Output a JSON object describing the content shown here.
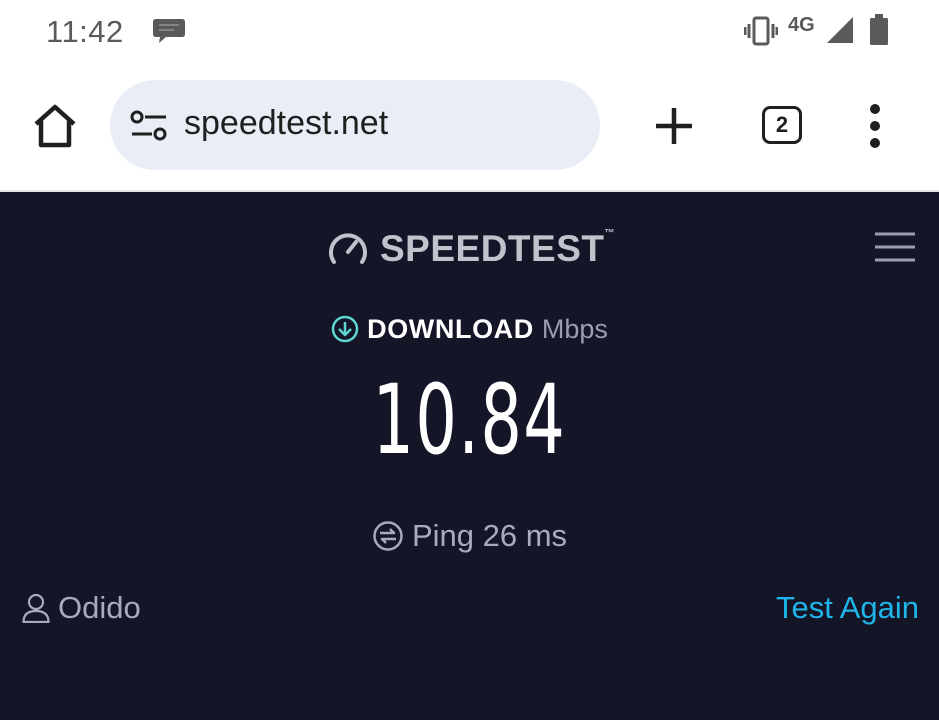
{
  "status_bar": {
    "time": "11:42",
    "network": "4G",
    "icons": [
      "chat-bubble-icon",
      "vibrate-icon",
      "signal-icon",
      "battery-icon"
    ]
  },
  "browser": {
    "url": "speedtest.net",
    "tab_count": "2",
    "url_bar_color": "#e9eef6",
    "icons": [
      "home-icon",
      "site-settings-icon",
      "plus-icon",
      "tabs-icon",
      "more-vert-icon"
    ]
  },
  "speedtest": {
    "logo_text": "SPEEDTEST",
    "download_label": "DOWNLOAD",
    "download_unit": "Mbps",
    "download_value": "10.84",
    "ping_text": "Ping 26 ms",
    "isp_name": "Odido",
    "test_again_label": "Test Again",
    "colors": {
      "background": "#141526",
      "accent": "#1fb5e9",
      "download_icon": "#5fd6d0"
    }
  }
}
